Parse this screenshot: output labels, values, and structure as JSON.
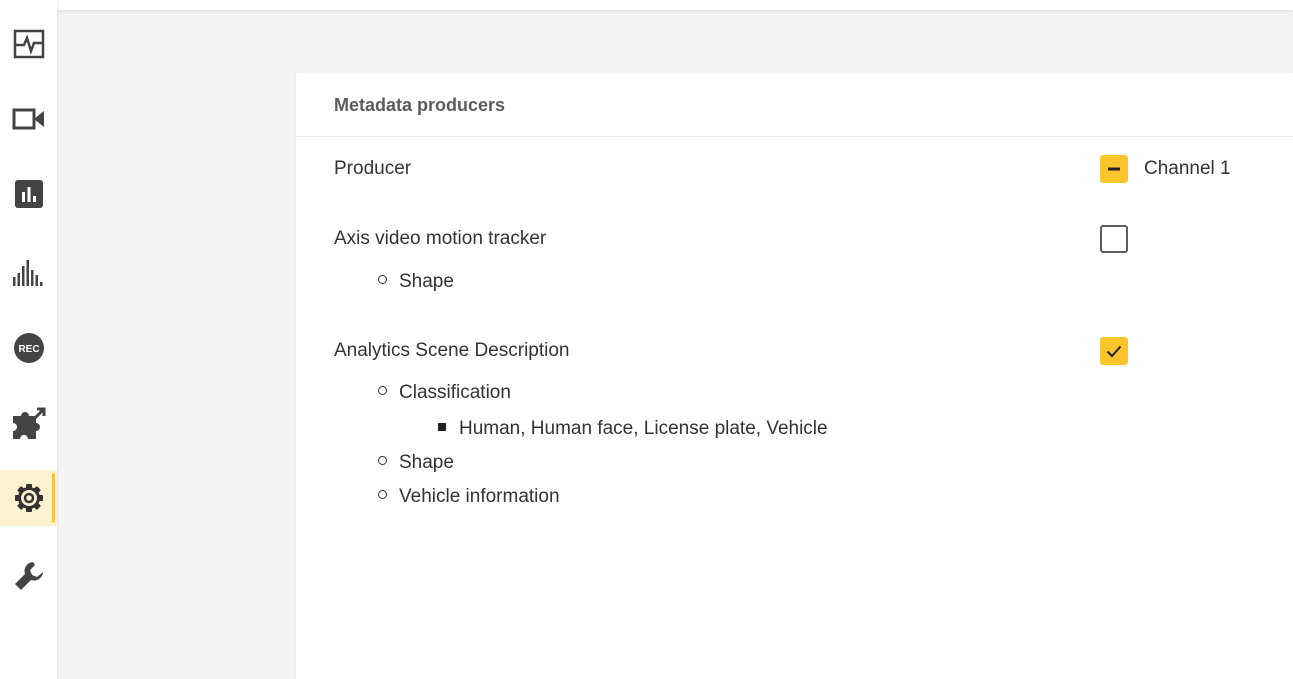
{
  "colors": {
    "accent": "#fdc42b",
    "active_bg": "#fdf1d0",
    "icon": "#444444"
  },
  "sidebar": {
    "items": [
      {
        "icon": "activity-monitor-icon",
        "active": false
      },
      {
        "icon": "video-camera-icon",
        "active": false
      },
      {
        "icon": "bar-chart-icon",
        "active": false
      },
      {
        "icon": "audio-levels-icon",
        "active": false
      },
      {
        "icon": "recording-icon",
        "label": "REC",
        "active": false
      },
      {
        "icon": "puzzle-apps-icon",
        "active": false
      },
      {
        "icon": "gear-settings-icon",
        "active": true
      },
      {
        "icon": "wrench-maintenance-icon",
        "active": false
      }
    ]
  },
  "card": {
    "title": "Metadata producers",
    "producer_header": "Producer",
    "channel_label": "Channel 1",
    "producers": [
      {
        "name": "Axis video motion tracker",
        "enabled": false,
        "items": [
          "Shape"
        ]
      },
      {
        "name": "Analytics Scene Description",
        "enabled": true,
        "items": [
          "Classification",
          "Shape",
          "Vehicle information"
        ],
        "classification_values": "Human, Human face, License plate, Vehicle"
      }
    ]
  }
}
